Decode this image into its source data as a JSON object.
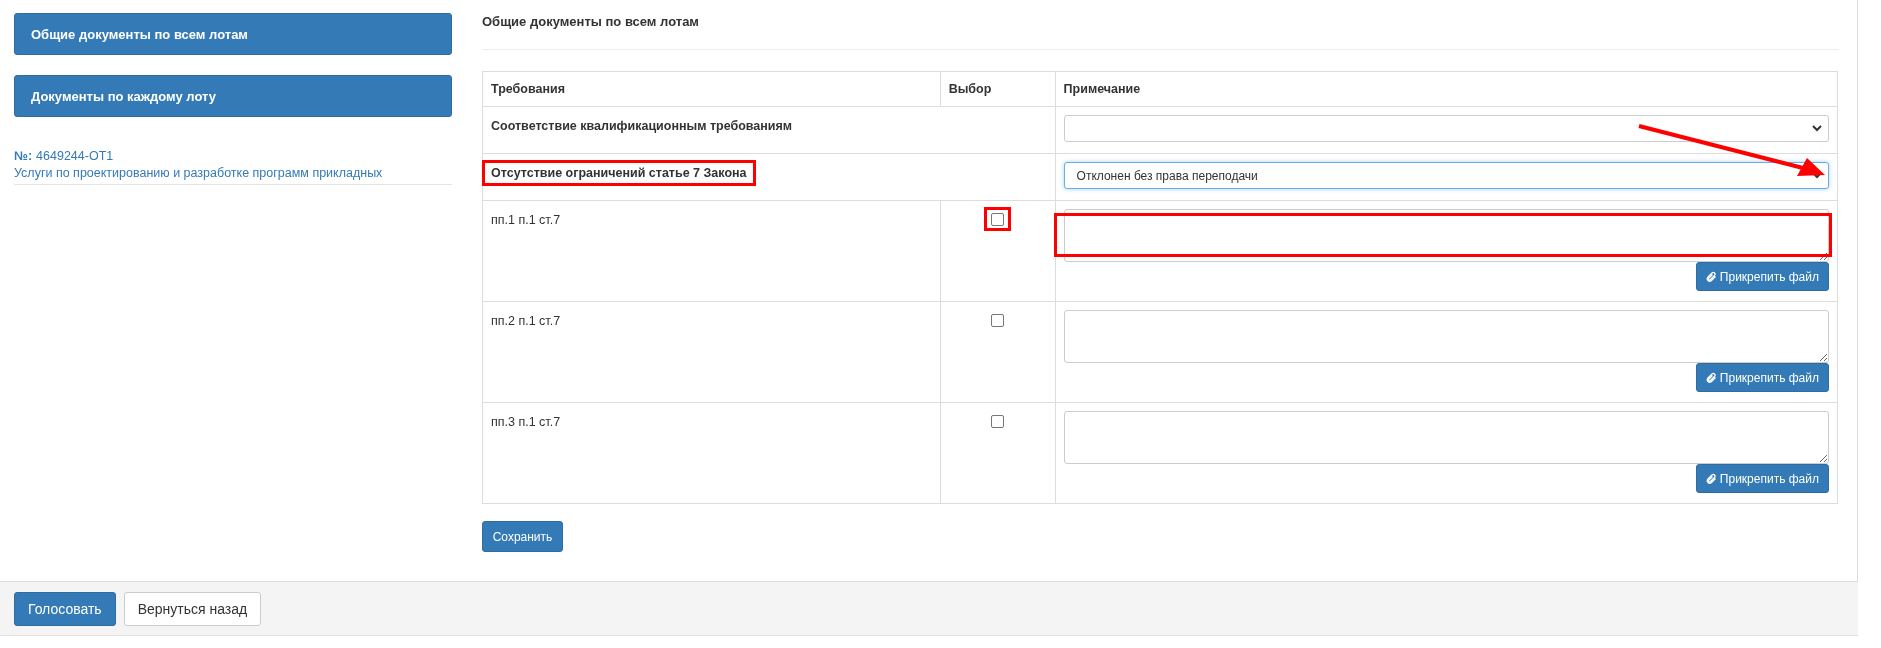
{
  "sidebar": {
    "buttons": [
      "Общие документы по всем лотам",
      "Документы по каждому лоту"
    ],
    "lot": {
      "number_label": "№:",
      "number": "4649244-ОТ1",
      "title": "Услуги по проектированию и разработке программ прикладных"
    }
  },
  "main": {
    "heading": "Общие документы по всем лотам",
    "table": {
      "columns": [
        "Требования",
        "Выбор",
        "Примечание"
      ],
      "rows": [
        {
          "kind": "group",
          "label": "Соответствие квалификационным требованиям",
          "highlighted": false,
          "select_value": "",
          "focused": false,
          "arrow_marked": false
        },
        {
          "kind": "group",
          "label": "Отсутствие ограничений статье 7 Закона",
          "highlighted": true,
          "select_value": "Отклонен без права переподачи",
          "focused": true,
          "arrow_marked": true
        },
        {
          "kind": "item",
          "label": "пп.1 п.1 ст.7",
          "checked": false,
          "checkbox_highlighted": true,
          "note_highlighted": true,
          "attach": "Прикрепить файл"
        },
        {
          "kind": "item",
          "label": "пп.2 п.1 ст.7",
          "checked": false,
          "checkbox_highlighted": false,
          "note_highlighted": false,
          "attach": "Прикрепить файл"
        },
        {
          "kind": "item",
          "label": "пп.3 п.1 ст.7",
          "checked": false,
          "checkbox_highlighted": false,
          "note_highlighted": false,
          "attach": "Прикрепить файл"
        }
      ]
    },
    "save": "Сохранить"
  },
  "footer": {
    "buttons": [
      {
        "label": "Голосовать",
        "kind": "primary"
      },
      {
        "label": "Вернуться назад",
        "kind": "default"
      }
    ]
  }
}
